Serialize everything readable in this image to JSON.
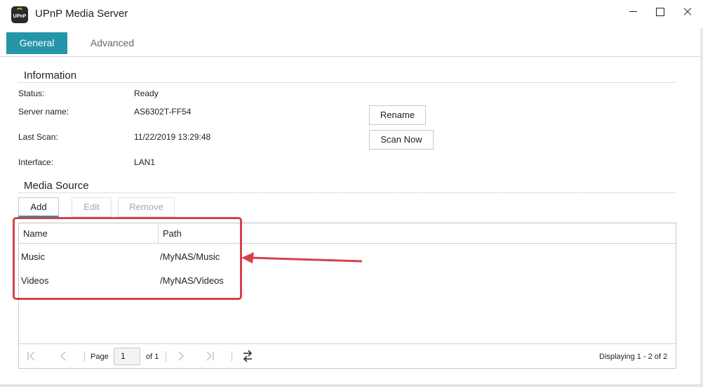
{
  "window": {
    "title": "UPnP Media Server",
    "app_icon_text": "UPnP",
    "controls": [
      "minimize",
      "maximize",
      "close"
    ]
  },
  "tabs": [
    {
      "label": "General",
      "active": true
    },
    {
      "label": "Advanced",
      "active": false
    }
  ],
  "information": {
    "section_title": "Information",
    "status_label": "Status:",
    "status_value": "Ready",
    "server_name_label": "Server name:",
    "server_name_value": "AS6302T-FF54",
    "last_scan_label": "Last Scan:",
    "last_scan_value": "11/22/2019 13:29:48",
    "interface_label": "Interface:",
    "interface_value": "LAN1",
    "rename_label": "Rename",
    "scan_now_label": "Scan Now"
  },
  "media_source": {
    "section_title": "Media Source",
    "toolbar": {
      "add": "Add",
      "edit": "Edit",
      "remove": "Remove"
    },
    "columns": [
      "Name",
      "Path"
    ],
    "rows": [
      {
        "name": "Music",
        "path": "/MyNAS/Music"
      },
      {
        "name": "Videos",
        "path": "/MyNAS/Videos"
      }
    ],
    "pager": {
      "page_label": "Page",
      "page_value": "1",
      "of_label": "of 1",
      "display_text": "Displaying 1 - 2 of 2"
    }
  },
  "colors": {
    "accent": "#2595a8",
    "annotation_red": "#d6414b"
  },
  "icons": {
    "pager": [
      "first-page-icon",
      "prev-page-icon",
      "next-page-icon",
      "last-page-icon",
      "refresh-icon"
    ]
  }
}
